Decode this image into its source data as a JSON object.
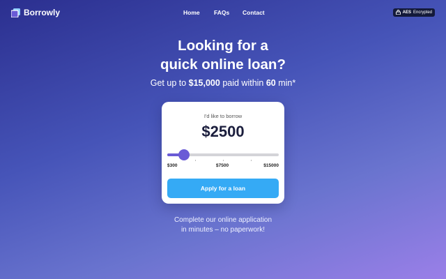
{
  "nav": {
    "brand": "Borrowly",
    "links": [
      "Home",
      "FAQs",
      "Contact"
    ],
    "badge_strong": "AES",
    "badge_text": "Encrypted"
  },
  "hero": {
    "headline_line1": "Looking for a",
    "headline_line2": "quick online loan?",
    "sub_prefix": "Get up to ",
    "sub_amount": "$15,000",
    "sub_middle": " paid within ",
    "sub_time": "60",
    "sub_suffix": " min*"
  },
  "calculator": {
    "label": "I'd like to borrow",
    "amount": "$2500",
    "slider": {
      "min": 300,
      "max": 15000,
      "value": 2500
    },
    "range_labels": [
      "$300",
      "$7500",
      "$15000"
    ],
    "apply_label": "Apply for a loan"
  },
  "footer": {
    "line1": "Complete our online application",
    "line2": "in minutes – no paperwork!"
  },
  "colors": {
    "accent": "#6a5bd6",
    "button": "#35aaf5"
  }
}
